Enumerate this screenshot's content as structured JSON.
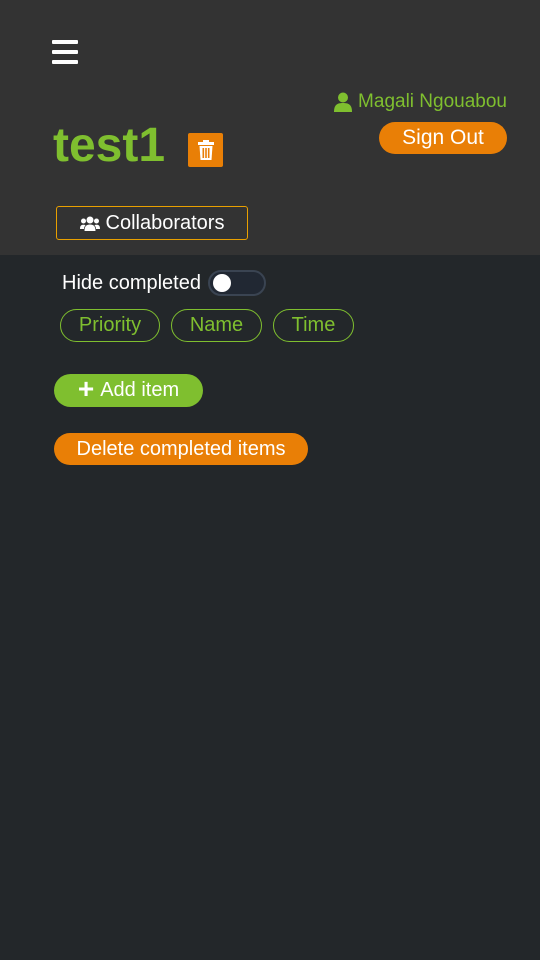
{
  "header": {
    "menu_icon": "hamburger-menu-icon",
    "user": {
      "icon": "user-icon",
      "name": "Magali Ngouabou",
      "color": "#7fbf2f"
    },
    "sign_out_label": "Sign Out",
    "list_title": "test1",
    "delete_list_icon": "trash-icon",
    "collaborators": {
      "icon": "users-icon",
      "label": "Collaborators"
    }
  },
  "controls": {
    "hide_completed_label": "Hide completed",
    "hide_completed_on": false,
    "sort_buttons": [
      "Priority",
      "Name",
      "Time"
    ]
  },
  "actions": {
    "add_item_label": "Add item",
    "add_icon": "plus-icon",
    "delete_completed_label": "Delete completed items"
  },
  "colors": {
    "accent_green": "#7fbf2f",
    "accent_orange": "#e97f06",
    "header_bg": "#333333",
    "page_bg": "#23272a"
  }
}
